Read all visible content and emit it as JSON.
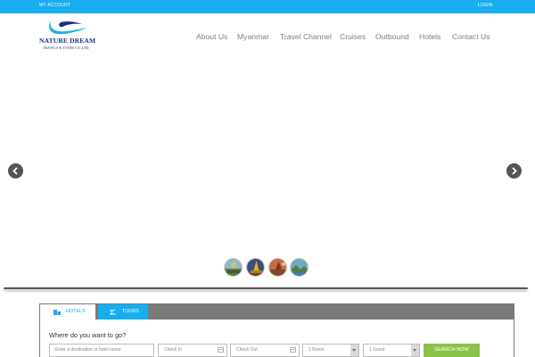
{
  "topbar": {
    "my_account": "MY ACCOUNT",
    "login": "LOGIN"
  },
  "logo": {
    "brand": "NATURE DREAM",
    "subtitle": "TRAVELS & TOURS CO.,LTD."
  },
  "nav": [
    {
      "label": "About Us"
    },
    {
      "label": "Myanmar"
    },
    {
      "label": "Travel Channel"
    },
    {
      "label": "Cruises"
    },
    {
      "label": "Outbound"
    },
    {
      "label": "Hotels"
    },
    {
      "label": "Contact Us"
    }
  ],
  "slider": {
    "prev_icon": "chevron-left-icon",
    "next_icon": "chevron-right-icon",
    "thumbnails": [
      "balloon-landscape",
      "golden-pagoda",
      "red-pagoda",
      "lake-landscape"
    ]
  },
  "search": {
    "tabs": [
      {
        "label": "HOTELS",
        "icon": "building-icon"
      },
      {
        "label": "TOURS",
        "icon": "island-icon"
      }
    ],
    "question": "Where do you want to go?",
    "destination_placeholder": "Enter a destination or hotel name",
    "check_in_placeholder": "Check In",
    "check_out_placeholder": "Check Out",
    "rooms_value": "1 Room",
    "guests_value": "1 Guest",
    "submit_label": "SEARCH NOW"
  },
  "colors": {
    "accent": "#17aef0",
    "brand": "#1d2f86",
    "submit": "#8bc34a",
    "nav_text": "#7e7e7e"
  }
}
